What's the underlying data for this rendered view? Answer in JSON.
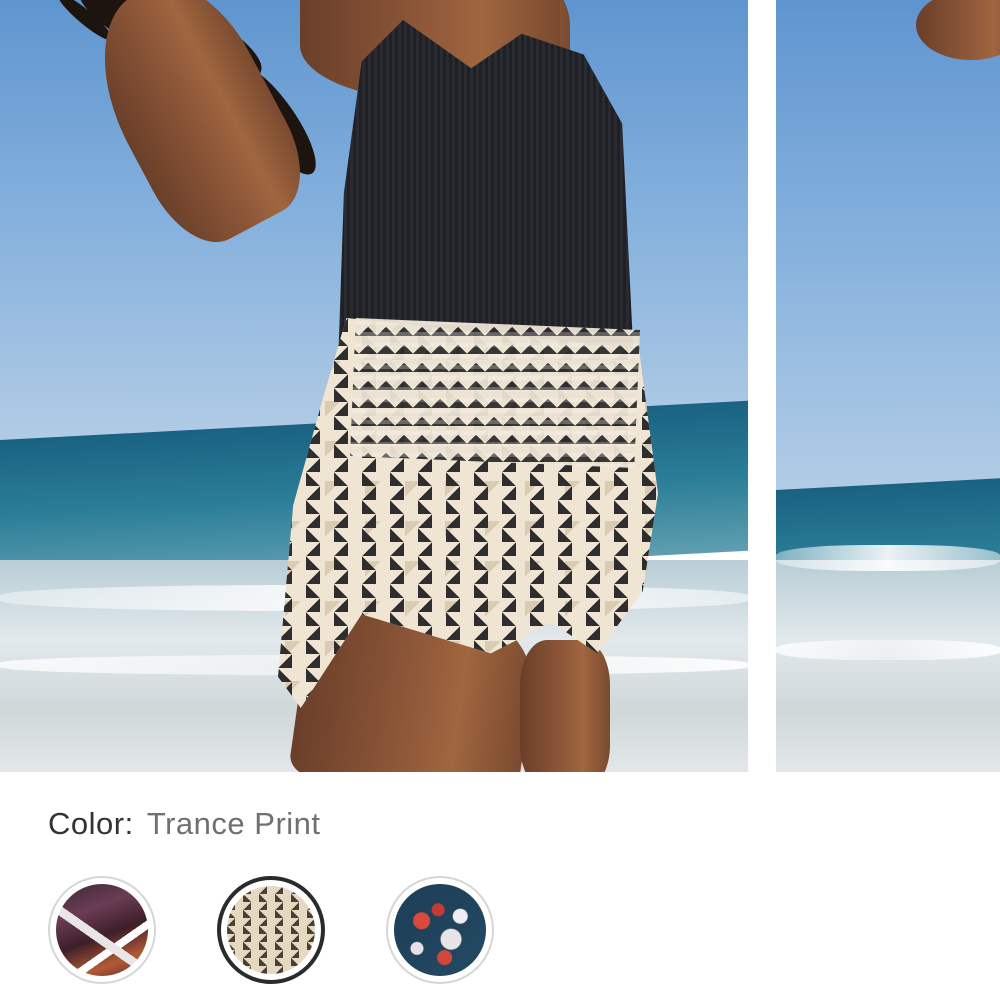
{
  "product_gallery": {
    "images": [
      {
        "alt": "Model wearing Trance Print shorts and black tank on beach"
      },
      {
        "alt": "Beach view second product image"
      }
    ]
  },
  "color_selector": {
    "label": "Color:",
    "selected_value": "Trance Print",
    "swatches": [
      {
        "name": "Multi print",
        "selected": false
      },
      {
        "name": "Trance Print",
        "selected": true
      },
      {
        "name": "Floral print",
        "selected": false
      }
    ]
  },
  "colors": {
    "label_text": "#333333",
    "value_text": "#707070",
    "selected_ring": "#2b2b2b",
    "unselected_ring": "#d6d6d6"
  }
}
